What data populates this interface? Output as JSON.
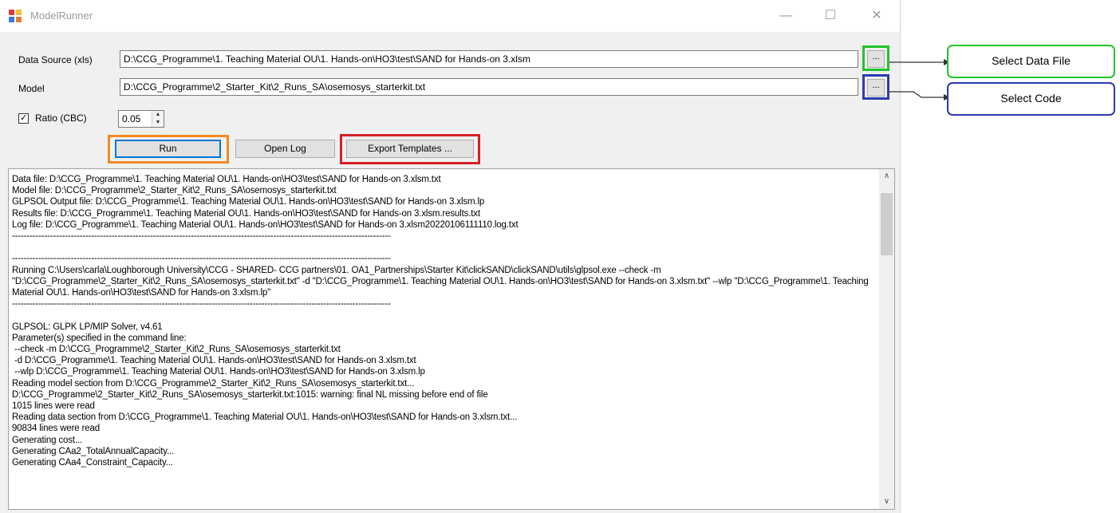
{
  "window": {
    "title": "ModelRunner",
    "minimize_glyph": "—",
    "maximize_glyph": "☐",
    "close_glyph": "✕"
  },
  "form": {
    "data_source_label": "Data Source (xls)",
    "data_source_value": "D:\\CCG_Programme\\1. Teaching Material OU\\1. Hands-on\\HO3\\test\\SAND for Hands-on 3.xlsm",
    "browse_label": "...",
    "model_label": "Model",
    "model_value": "D:\\CCG_Programme\\2_Starter_Kit\\2_Runs_SA\\osemosys_starterkit.txt",
    "ratio_label": "Ratio (CBC)",
    "ratio_checked": true,
    "ratio_value": "0.05"
  },
  "buttons": {
    "run": "Run",
    "open_log": "Open Log",
    "export_templates": "Export Templates ..."
  },
  "log_text": "Data file: D:\\CCG_Programme\\1. Teaching Material OU\\1. Hands-on\\HO3\\test\\SAND for Hands-on 3.xlsm.txt\nModel file: D:\\CCG_Programme\\2_Starter_Kit\\2_Runs_SA\\osemosys_starterkit.txt\nGLPSOL Output file: D:\\CCG_Programme\\1. Teaching Material OU\\1. Hands-on\\HO3\\test\\SAND for Hands-on 3.xlsm.lp\nResults file: D:\\CCG_Programme\\1. Teaching Material OU\\1. Hands-on\\HO3\\test\\SAND for Hands-on 3.xlsm.results.txt\nLog file: D:\\CCG_Programme\\1. Teaching Material OU\\1. Hands-on\\HO3\\test\\SAND for Hands-on 3.xlsm20220106111110.log.txt\n---------------------------------------------------------------------------------------------------------------------------------\n\n---------------------------------------------------------------------------------------------------------------------------------\nRunning C:\\Users\\carla\\Loughborough University\\CCG - SHARED- CCG partners\\01. OA1_Partnerships\\Starter Kit\\clickSAND\\clickSAND\\utils\\glpsol.exe --check -m \"D:\\CCG_Programme\\2_Starter_Kit\\2_Runs_SA\\osemosys_starterkit.txt\" -d \"D:\\CCG_Programme\\1. Teaching Material OU\\1. Hands-on\\HO3\\test\\SAND for Hands-on 3.xlsm.txt\" --wlp \"D:\\CCG_Programme\\1. Teaching Material OU\\1. Hands-on\\HO3\\test\\SAND for Hands-on 3.xlsm.lp\"\n---------------------------------------------------------------------------------------------------------------------------------\n\nGLPSOL: GLPK LP/MIP Solver, v4.61\nParameter(s) specified in the command line:\n --check -m D:\\CCG_Programme\\2_Starter_Kit\\2_Runs_SA\\osemosys_starterkit.txt\n -d D:\\CCG_Programme\\1. Teaching Material OU\\1. Hands-on\\HO3\\test\\SAND for Hands-on 3.xlsm.txt\n --wlp D:\\CCG_Programme\\1. Teaching Material OU\\1. Hands-on\\HO3\\test\\SAND for Hands-on 3.xlsm.lp\nReading model section from D:\\CCG_Programme\\2_Starter_Kit\\2_Runs_SA\\osemosys_starterkit.txt...\nD:\\CCG_Programme\\2_Starter_Kit\\2_Runs_SA\\osemosys_starterkit.txt:1015: warning: final NL missing before end of file\n1015 lines were read\nReading data section from D:\\CCG_Programme\\1. Teaching Material OU\\1. Hands-on\\HO3\\test\\SAND for Hands-on 3.xlsm.txt...\n90834 lines were read\nGenerating cost...\nGenerating CAa2_TotalAnnualCapacity...\nGenerating CAa4_Constraint_Capacity...",
  "callouts": {
    "select_data_file": "Select Data File",
    "select_code": "Select Code"
  },
  "colors": {
    "highlight_data_browse": "#22c42a",
    "highlight_model_browse": "#2b3bb0",
    "highlight_run": "#f08a24",
    "highlight_export": "#d61f26"
  },
  "icons": {
    "app": "model-runner-app-icon",
    "scroll_up": "∧",
    "scroll_down": "∨",
    "spin_up": "▲",
    "spin_down": "▼",
    "check": "✓"
  }
}
